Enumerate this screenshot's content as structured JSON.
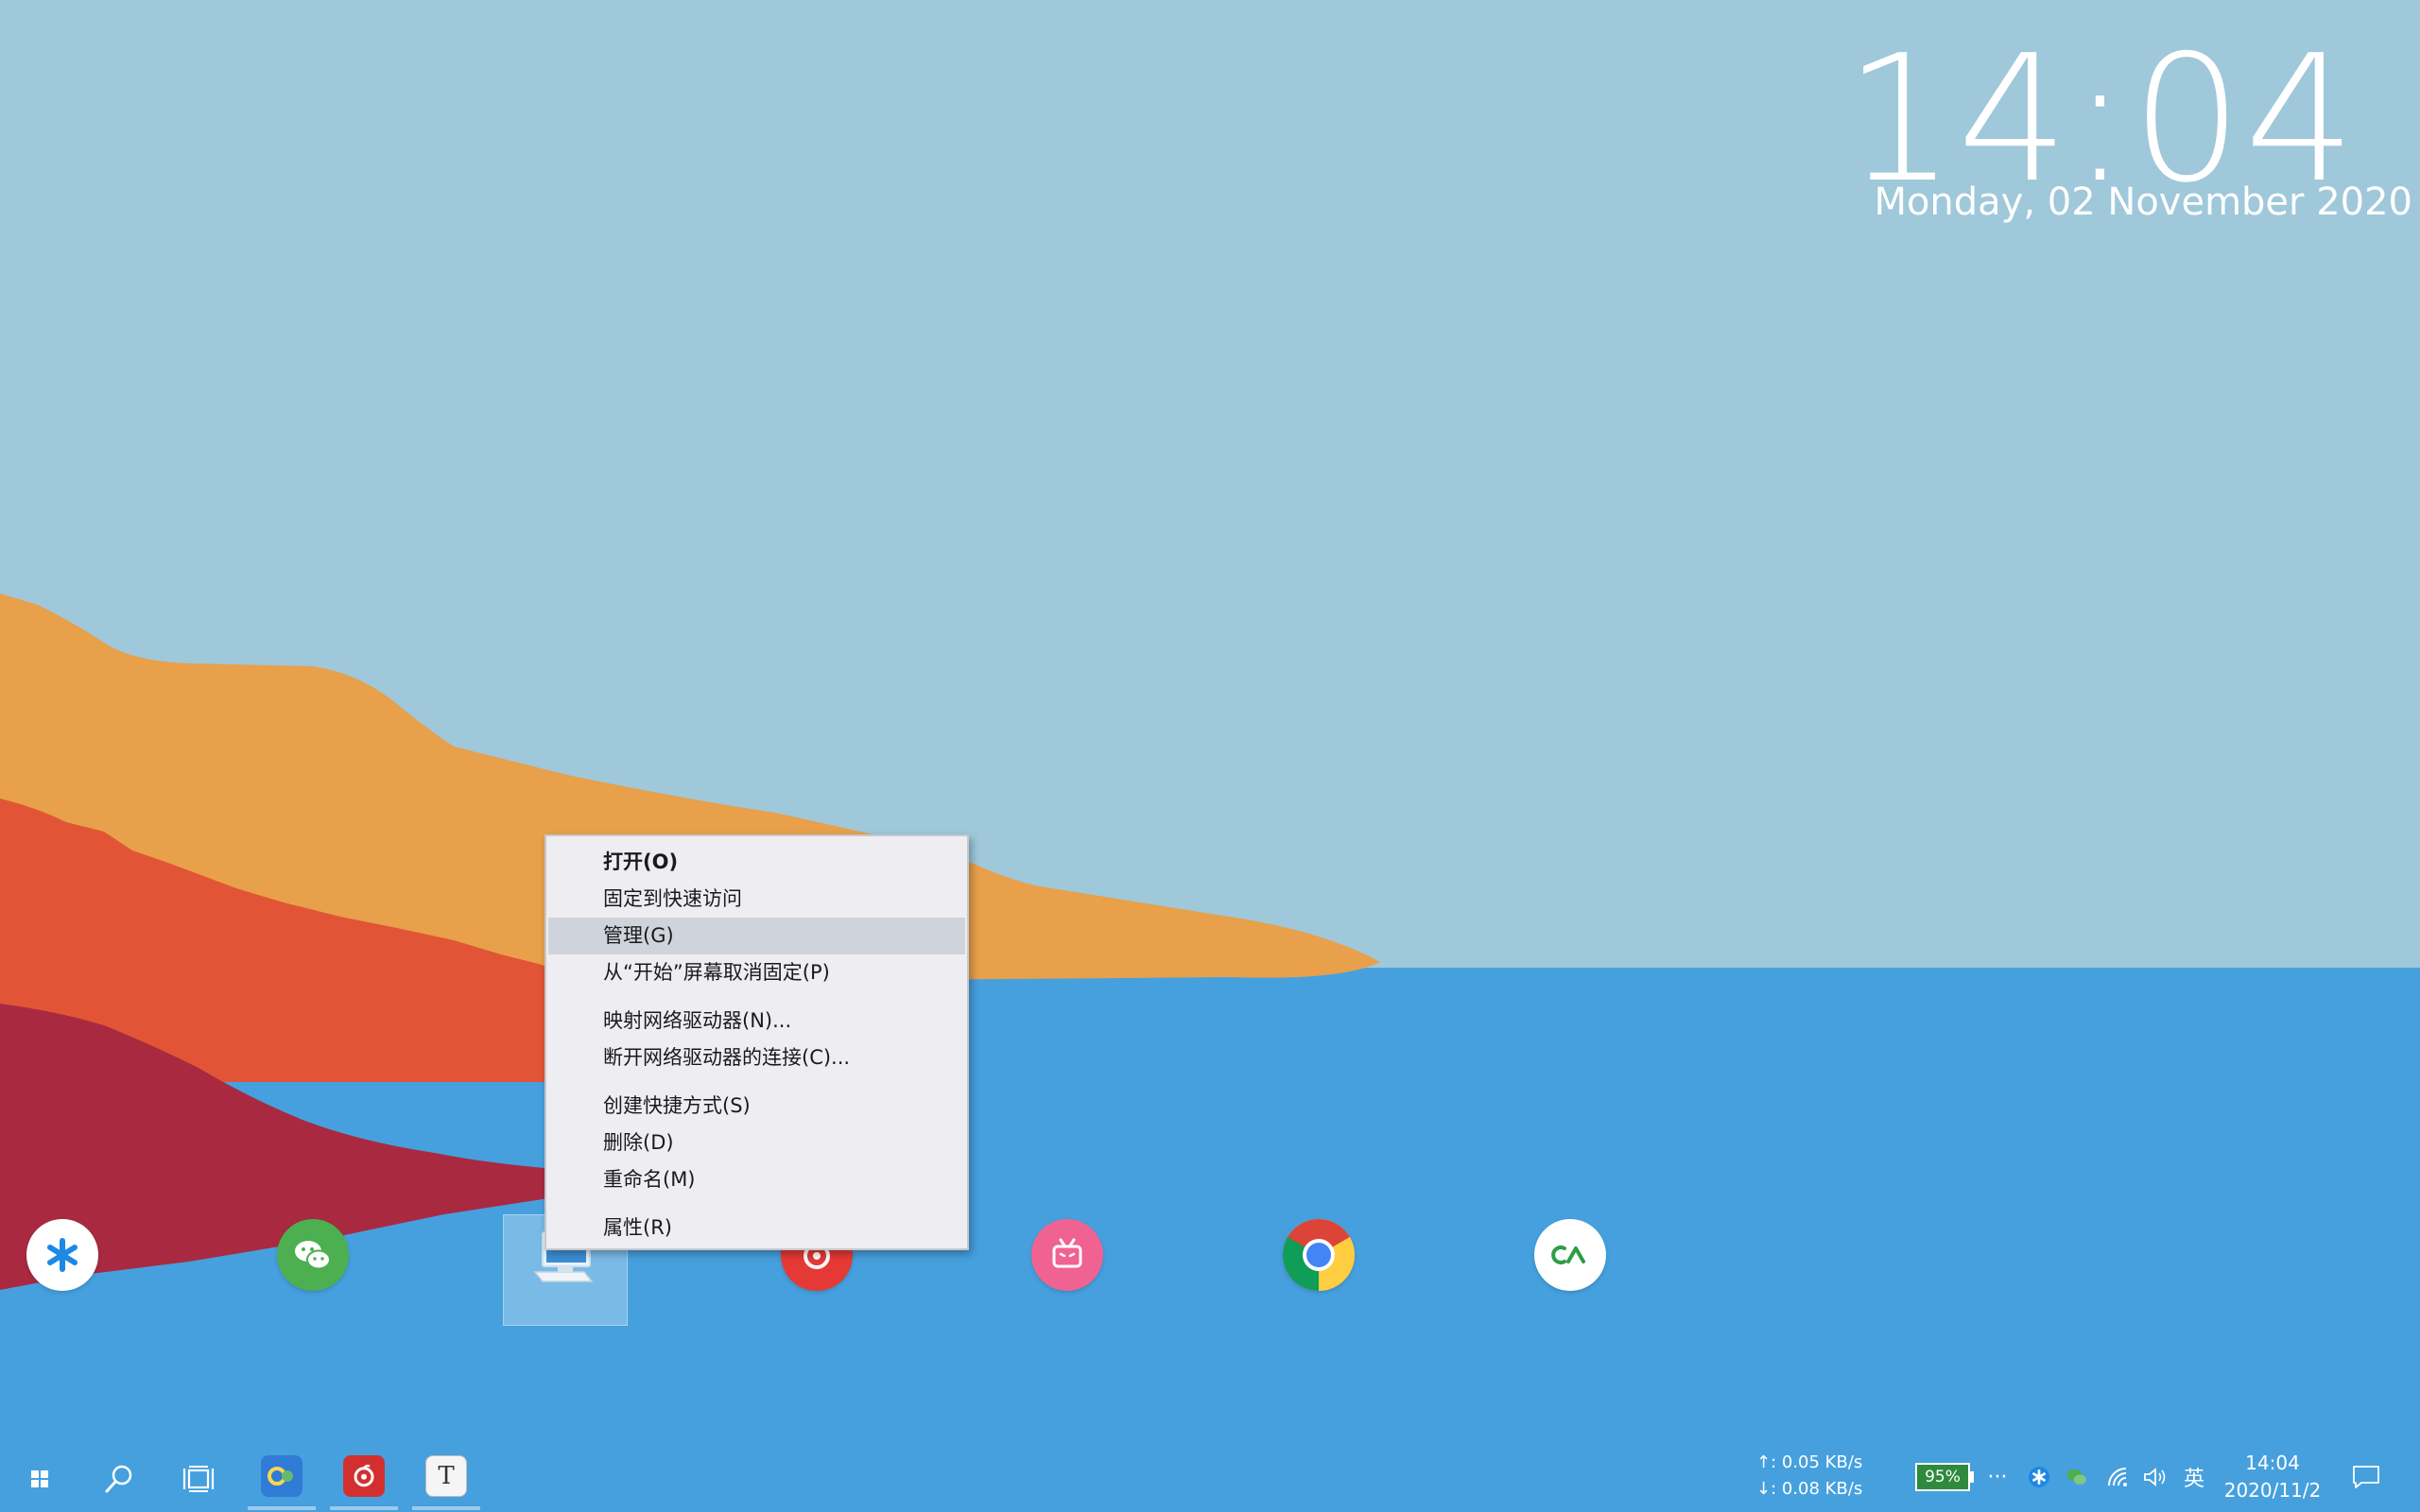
{
  "clock_widget": {
    "time": "14:04",
    "date": "Monday, 02 November 2020"
  },
  "desktop_icons": [
    {
      "name": "asterisk-app-icon",
      "color": "#ffffff",
      "glyph_color": "#1e88e5"
    },
    {
      "name": "wechat-icon",
      "color": "#4caf50"
    },
    {
      "name": "this-pc-icon",
      "selected": true
    },
    {
      "name": "netease-music-icon",
      "color": "#e53935"
    },
    {
      "name": "bilibili-icon",
      "color": "#f06292"
    },
    {
      "name": "chrome-icon"
    },
    {
      "name": "ca-app-icon",
      "color": "#ffffff",
      "glyph_color": "#2e9d43"
    }
  ],
  "context_menu": {
    "items": [
      {
        "label": "打开(O)",
        "bold": true
      },
      {
        "label": "固定到快速访问"
      },
      {
        "label": "管理(G)",
        "highlighted": true
      },
      {
        "label": "从“开始”屏幕取消固定(P)"
      },
      {
        "separator": true
      },
      {
        "label": "映射网络驱动器(N)..."
      },
      {
        "label": "断开网络驱动器的连接(C)..."
      },
      {
        "separator": true
      },
      {
        "label": "创建快捷方式(S)"
      },
      {
        "label": "删除(D)"
      },
      {
        "label": "重命名(M)"
      },
      {
        "separator": true
      },
      {
        "label": "属性(R)"
      }
    ]
  },
  "taskbar": {
    "buttons": [
      "start-icon",
      "search-icon",
      "task-view-icon"
    ],
    "pinned_apps": [
      "browser-icon",
      "netease-music-icon",
      "typora-icon"
    ],
    "typora_glyph": "T",
    "network_speed": {
      "upload": "↑: 0.05 KB/s",
      "download": "↓: 0.08 KB/s"
    },
    "battery": "95%",
    "overflow": "···",
    "input_method": "英",
    "clock": {
      "time": "14:04",
      "date": "2020/11/2"
    }
  },
  "colors": {
    "sky": "#9fc8da",
    "sea": "#46a0de",
    "hill_orange": "#e8a04a",
    "hill_red": "#e15536",
    "hill_crimson": "#a92a40"
  }
}
